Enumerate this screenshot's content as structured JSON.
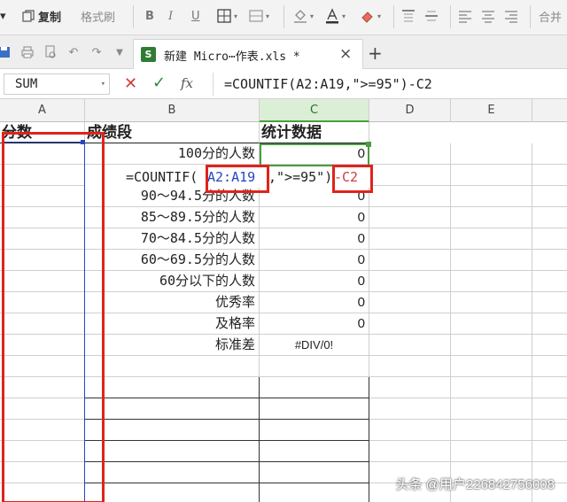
{
  "ribbon": {
    "paste_caret": "▾",
    "copy_label": "复制",
    "format_painter_label": "格式刷",
    "bold_label": "B",
    "italic_label": "I",
    "underline_label": "U",
    "merge_label": "合并"
  },
  "tabbar": {
    "doc_tab_label": "新建 Micro⋯作表.xls *",
    "doc_tab_close": "×",
    "new_tab": "+"
  },
  "formula_bar": {
    "name_box": "SUM",
    "cancel": "✕",
    "enter": "✓",
    "fx_label": "fx",
    "formula": "=COUNTIF(A2:A19,\">=95\")-C2"
  },
  "columns": [
    "A",
    "B",
    "C",
    "D",
    "E"
  ],
  "sheet": {
    "header": {
      "a": "分数",
      "b": "成绩段",
      "c": "统计数据"
    },
    "rows": [
      {
        "label": "100分的人数",
        "value": "0"
      },
      {
        "label": "",
        "value": ""
      },
      {
        "label": "90～94.5分的人数",
        "value": "0"
      },
      {
        "label": "85～89.5分的人数",
        "value": "0"
      },
      {
        "label": "70～84.5分的人数",
        "value": "0"
      },
      {
        "label": "60～69.5分的人数",
        "value": "0"
      },
      {
        "label": "60分以下的人数",
        "value": "0"
      },
      {
        "label": "优秀率",
        "value": "0"
      },
      {
        "label": "及格率",
        "value": "0"
      },
      {
        "label": "标准差",
        "value": "#DIV/0!"
      }
    ],
    "editing_cell": {
      "prefix": "=COUNTIF(",
      "range_ref": "A2:A19",
      "middle": ",\">=95\")",
      "suffix": "-C2"
    }
  },
  "watermark": "头条 @用户226842756008",
  "colors": {
    "highlight_red": "#e0231b",
    "range_blue": "#2446c4",
    "active_green": "#4a9d3f"
  }
}
